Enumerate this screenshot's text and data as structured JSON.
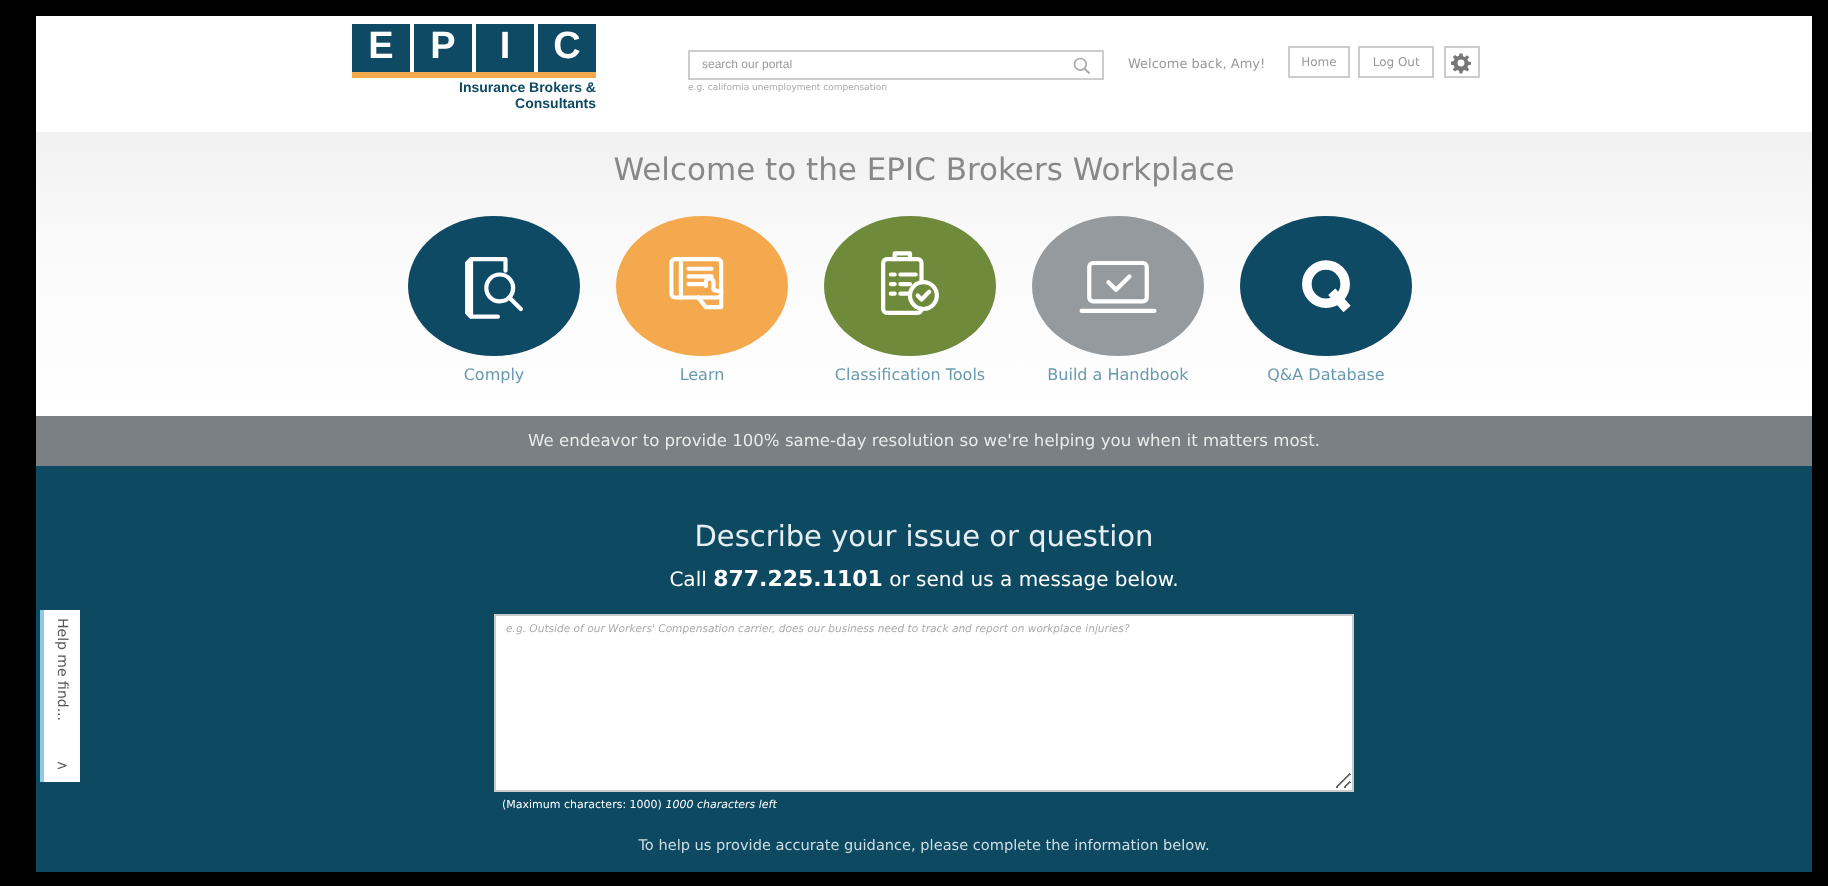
{
  "header": {
    "logo_letters": [
      "E",
      "P",
      "I",
      "C"
    ],
    "logo_subtitle": "Insurance Brokers &\nConsultants",
    "search": {
      "placeholder": "search our portal",
      "hint": "e.g. california unemployment compensation"
    },
    "greeting": "Welcome back, Amy!",
    "buttons": [
      "Home",
      "Log Out"
    ]
  },
  "welcome_title": "Welcome to the EPIC Brokers Workplace",
  "tiles": [
    {
      "label": "Comply",
      "kind": "comply",
      "color": "#0e4a63"
    },
    {
      "label": "Learn",
      "kind": "learn",
      "color": "#f4a94f"
    },
    {
      "label": "Classification Tools",
      "kind": "classify",
      "color": "#6f8a3a"
    },
    {
      "label": "Build a Handbook",
      "kind": "handbook",
      "color": "#959a9e"
    },
    {
      "label": "Q&A Database",
      "kind": "qa",
      "color": "#0e4a63"
    }
  ],
  "banner": "We endeavor to provide 100% same-day resolution so we're helping you when it matters most.",
  "contact": {
    "title": "Describe your issue or question",
    "call_line": "Call **877.225.1101** or send us a message below.",
    "message": {
      "placeholder": "e.g. Outside of our Workers' Compensation carrier, does our business need to track and report on workplace injuries?"
    },
    "limit_note": "(Maximum characters: 1000) *1000 characters left*",
    "footer_note": "To help us provide accurate guidance, please complete the information below."
  },
  "help_tab": {
    "label": "Help me find...",
    "arrow": ">"
  }
}
